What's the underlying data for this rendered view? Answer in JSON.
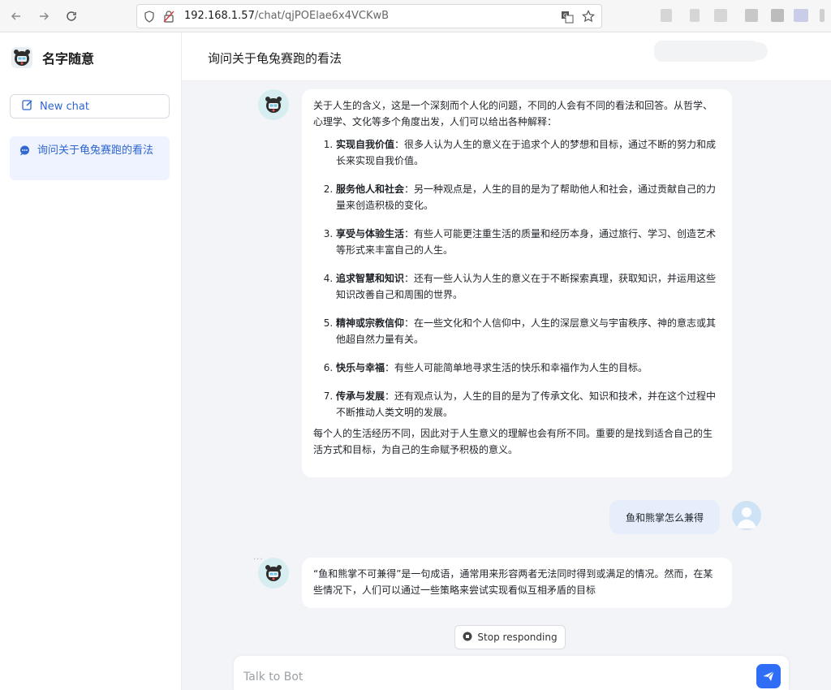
{
  "browser": {
    "url_host": "192.168.1.57",
    "url_path": "/chat/qjPOElae6x4VCKwB"
  },
  "sidebar": {
    "app_name": "名字随意",
    "new_chat_label": "New chat",
    "chats": [
      {
        "label": "询问关于龟兔赛跑的看法",
        "active": true
      }
    ]
  },
  "main": {
    "title": "询问关于龟兔赛跑的看法",
    "messages": [
      {
        "role": "bot",
        "intro": "关于人生的含义，这是一个深刻而个人化的问题，不同的人会有不同的看法和回答。从哲学、心理学、文化等多个角度出发，人们可以给出各种解释：",
        "items": [
          {
            "title": "实现自我价值",
            "text": "：很多人认为人生的意义在于追求个人的梦想和目标，通过不断的努力和成长来实现自我价值。"
          },
          {
            "title": "服务他人和社会",
            "text": "：另一种观点是，人生的目的是为了帮助他人和社会，通过贡献自己的力量来创造积极的变化。"
          },
          {
            "title": "享受与体验生活",
            "text": "：有些人可能更注重生活的质量和经历本身，通过旅行、学习、创造艺术等形式来丰富自己的人生。"
          },
          {
            "title": "追求智慧和知识",
            "text": "：还有一些人认为人生的意义在于不断探索真理，获取知识，并运用这些知识改善自己和周围的世界。"
          },
          {
            "title": "精神或宗教信仰",
            "text": "：在一些文化和个人信仰中，人生的深层意义与宇宙秩序、神的意志或其他超自然力量有关。"
          },
          {
            "title": "快乐与幸福",
            "text": "：有些人可能简单地寻求生活的快乐和幸福作为人生的目标。"
          },
          {
            "title": "传承与发展",
            "text": "：还有观点认为，人生的目的是为了传承文化、知识和技术，并在这个过程中不断推动人类文明的发展。"
          }
        ],
        "outro": "每个人的生活经历不同，因此对于人生意义的理解也会有所不同。重要的是找到适合自己的生活方式和目标，为自己的生命赋予积极的意义。"
      },
      {
        "role": "user",
        "text": "鱼和熊掌怎么兼得"
      },
      {
        "role": "bot",
        "text": "“鱼和熊掌不可兼得”是一句成语，通常用来形容两者无法同时得到或满足的情况。然而，在某些情况下，人们可以通过一些策略来尝试实现看似互相矛盾的目标"
      }
    ],
    "stop_label": "Stop responding",
    "input_placeholder": "Talk to Bot"
  },
  "colors": {
    "accent": "#2f66d0",
    "send_button": "#2f6df6",
    "active_chat_bg": "#eef3ff",
    "user_bubble": "#e6eefb"
  }
}
